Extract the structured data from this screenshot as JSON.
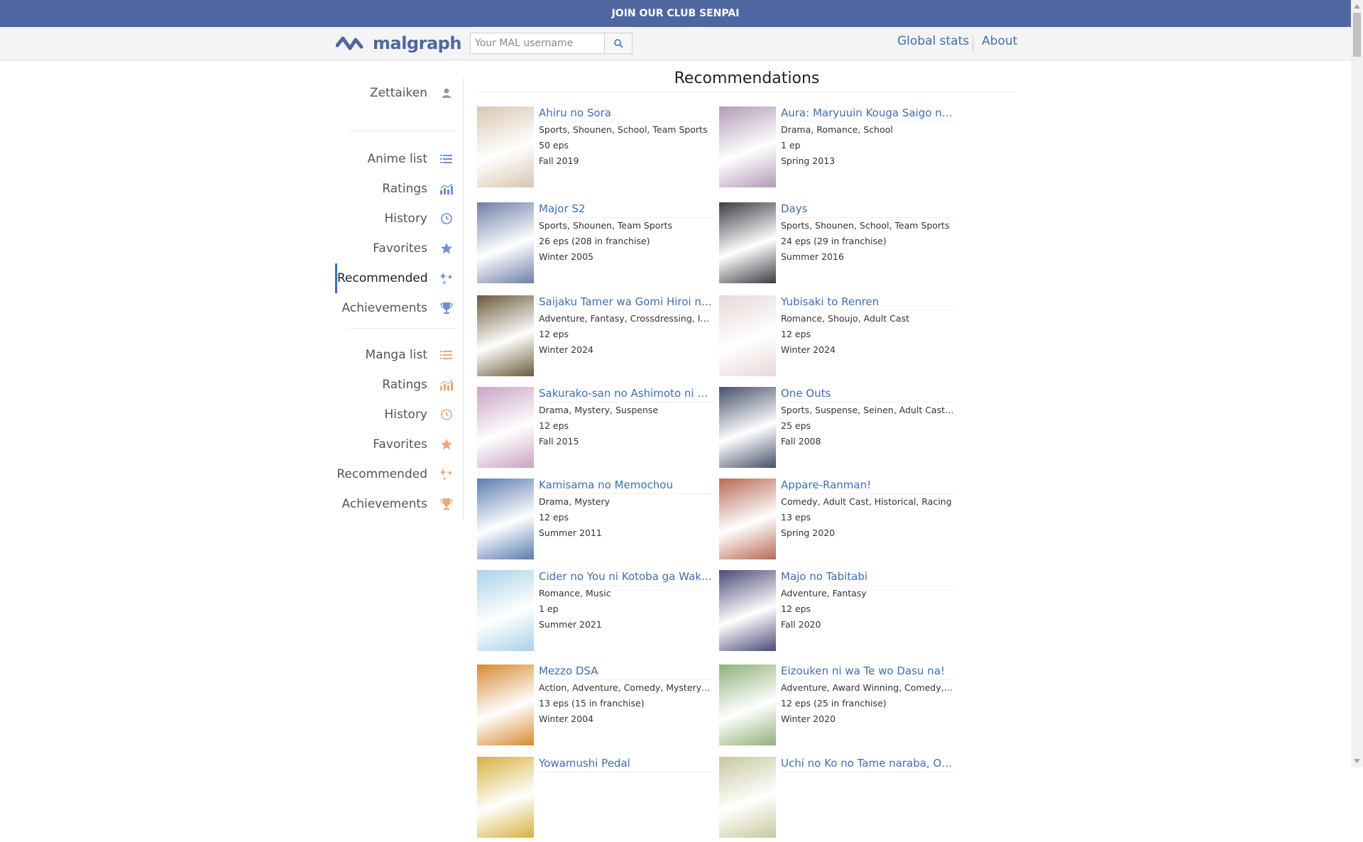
{
  "banner": {
    "text": "JOIN OUR CLUB SENPAI"
  },
  "header": {
    "logo_text": "malgraph",
    "search_placeholder": "Your MAL username",
    "nav": [
      "Global stats",
      "About"
    ]
  },
  "sidebar": {
    "user": "Zettaiken",
    "anime": [
      "Anime list",
      "Ratings",
      "History",
      "Favorites",
      "Recommended",
      "Achievements"
    ],
    "manga": [
      "Manga list",
      "Ratings",
      "History",
      "Favorites",
      "Recommended",
      "Achievements"
    ],
    "active": "Recommended (anime)",
    "colors": {
      "anime_icon": "#6e8fd0",
      "manga_icon": "#f0a573",
      "active_border": "#3f6fb0"
    }
  },
  "main": {
    "title": "Recommendations",
    "items": [
      {
        "title": "Ahiru no Sora",
        "genres": "Sports, Shounen, School, Team Sports",
        "eps": "50 eps",
        "season": "Fall 2019",
        "poster_color": "#d9c6b0"
      },
      {
        "title": "Aura: Maryuuin Kouga Saigo no T...",
        "genres": "Drama, Romance, School",
        "eps": "1 ep",
        "season": "Spring 2013",
        "poster_color": "#b49ab8"
      },
      {
        "title": "Major S2",
        "genres": "Sports, Shounen, Team Sports",
        "eps": "26 eps (208 in franchise)",
        "season": "Winter 2005",
        "poster_color": "#6e7fa8"
      },
      {
        "title": "Days",
        "genres": "Sports, Shounen, School, Team Sports",
        "eps": "24 eps (29 in franchise)",
        "season": "Summer 2016",
        "poster_color": "#3c3c44"
      },
      {
        "title": "Saijaku Tamer wa Gomi Hiroi no ...",
        "genres": "Adventure, Fantasy, Crossdressing, Isek...",
        "eps": "12 eps",
        "season": "Winter 2024",
        "poster_color": "#6b5a3a"
      },
      {
        "title": "Yubisaki to Renren",
        "genres": "Romance, Shoujo, Adult Cast",
        "eps": "12 eps",
        "season": "Winter 2024",
        "poster_color": "#e8d8d8"
      },
      {
        "title": "Sakurako-san no Ashimoto ni wa ...",
        "genres": "Drama, Mystery, Suspense",
        "eps": "12 eps",
        "season": "Fall 2015",
        "poster_color": "#c9a2c4"
      },
      {
        "title": "One Outs",
        "genres": "Sports, Suspense, Seinen, Adult Cast, P...",
        "eps": "25 eps",
        "season": "Fall 2008",
        "poster_color": "#46506a"
      },
      {
        "title": "Kamisama no Memochou",
        "genres": "Drama, Mystery",
        "eps": "12 eps",
        "season": "Summer 2011",
        "poster_color": "#5b7bb0"
      },
      {
        "title": "Appare-Ranman!",
        "genres": "Comedy, Adult Cast, Historical, Racing",
        "eps": "13 eps",
        "season": "Spring 2020",
        "poster_color": "#b86a55"
      },
      {
        "title": "Cider no You ni Kotoba ga Wakia...",
        "genres": "Romance, Music",
        "eps": "1 ep",
        "season": "Summer 2021",
        "poster_color": "#a9d2e8"
      },
      {
        "title": "Majo no Tabitabi",
        "genres": "Adventure, Fantasy",
        "eps": "12 eps",
        "season": "Fall 2020",
        "poster_color": "#4c4a78"
      },
      {
        "title": "Mezzo DSA",
        "genres": "Action, Adventure, Comedy, Mystery, Sc...",
        "eps": "13 eps (15 in franchise)",
        "season": "Winter 2004",
        "poster_color": "#d68a30"
      },
      {
        "title": "Eizouken ni wa Te wo Dasu na!",
        "genres": "Adventure, Award Winning, Comedy, Se...",
        "eps": "12 eps (25 in franchise)",
        "season": "Winter 2020",
        "poster_color": "#8fb07a"
      },
      {
        "title": "Yowamushi Pedal",
        "genres": "",
        "eps": "",
        "season": "",
        "poster_color": "#d8b040"
      },
      {
        "title": "Uchi no Ko no Tame naraba, Ore...",
        "genres": "",
        "eps": "",
        "season": "",
        "poster_color": "#c8c8a0"
      }
    ]
  }
}
